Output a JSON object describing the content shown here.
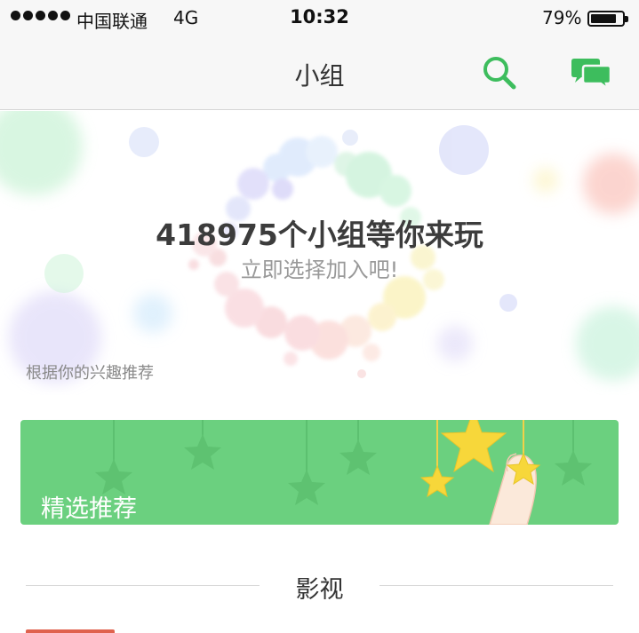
{
  "status_bar": {
    "carrier": "中国联通",
    "network": "4G",
    "time": "10:32",
    "battery_percent": "79%",
    "battery_level": 0.79
  },
  "nav": {
    "title": "小组",
    "search_icon": "search-icon",
    "message_icon": "chat-bubbles-icon",
    "accent_color": "#3dbd5d"
  },
  "hero": {
    "headline": "418975个小组等你来玩",
    "subline": "立即选择加入吧!",
    "recommend_label": "根据你的兴趣推荐"
  },
  "banner": {
    "label": "精选推荐",
    "background_color": "#6bd07f",
    "star_color": "#f7d73a"
  },
  "section": {
    "title": "影视"
  }
}
